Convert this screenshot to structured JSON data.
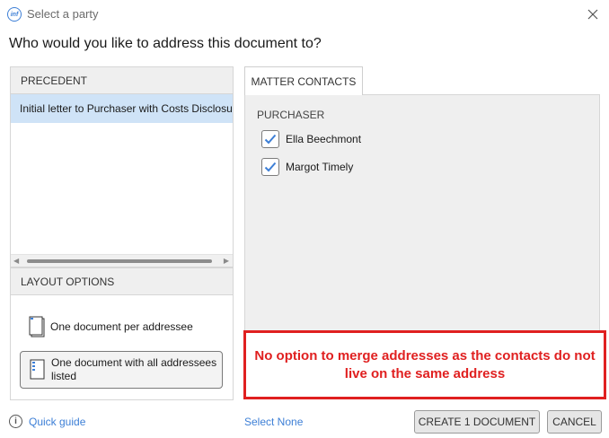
{
  "window": {
    "title": "Select a party",
    "logo_text": "inf"
  },
  "heading": "Who would you like to address this document to?",
  "precedent": {
    "header": "PRECEDENT",
    "items": [
      {
        "label": "Initial letter to Purchaser with Costs Disclosure",
        "selected": true
      }
    ]
  },
  "layout_options": {
    "header": "LAYOUT OPTIONS",
    "options": [
      {
        "label": "One document per addressee",
        "selected": false
      },
      {
        "label": "One document with all addressees listed",
        "selected": true
      }
    ]
  },
  "matter_contacts": {
    "tab_label": "MATTER CONTACTS",
    "group": "PURCHASER",
    "contacts": [
      {
        "name": "Ella Beechmont",
        "checked": true
      },
      {
        "name": "Margot Timely",
        "checked": true
      }
    ]
  },
  "annotation": {
    "text": "No option to merge addresses as the contacts do not live on the same address",
    "color": "#e02020"
  },
  "footer": {
    "quick_guide": "Quick guide",
    "select_none": "Select None",
    "create_button": "CREATE 1 DOCUMENT",
    "cancel_button": "CANCEL"
  },
  "colors": {
    "accent": "#3d7fd6",
    "selection": "#cfe3f7"
  }
}
